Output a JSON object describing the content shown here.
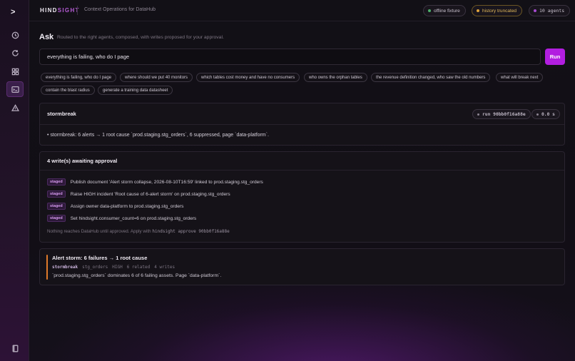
{
  "rail": {
    "logo": ">",
    "items": [
      {
        "name": "history-icon"
      },
      {
        "name": "refresh-icon"
      },
      {
        "name": "grid-icon"
      },
      {
        "name": "terminal-icon",
        "active": true
      },
      {
        "name": "alert-icon"
      }
    ],
    "bottom_icon": "book-icon"
  },
  "topbar": {
    "brand_main": "HIND",
    "brand_accent": "SIGHT",
    "subtitle": "Context Operations for DataHub",
    "pills": [
      {
        "label": "offline fixture",
        "dot_color": "#4caf6a"
      },
      {
        "label": "history truncated",
        "dot_color": "#e0a43a"
      },
      {
        "label": "10 agents",
        "dot_color": "#a64bd0"
      }
    ]
  },
  "ask": {
    "title": "Ask",
    "subtitle": "Routed to the right agents, composed, with writes proposed for your approval.",
    "query": "everything is failing, who do I page",
    "run_label": "Run"
  },
  "chips": [
    "everything is failing, who do I page",
    "where should we put 40 monitors",
    "which tables cost money and have no consumers",
    "who owns the orphan tables",
    "the revenue definition changed, who saw the old numbers",
    "what will break next",
    "contain the blast radius",
    "generate a training data datasheet"
  ],
  "result": {
    "agent": "stormbreak",
    "run_id": "run 90bb0f16a88e",
    "duration": "0.0 s",
    "summary": "• stormbreak: 6 alerts → 1 root cause `prod.staging.stg_orders`, 6 suppressed, page `data-platform`."
  },
  "approvals": {
    "title": "4 write(s) awaiting approval",
    "tag": "staged",
    "items": [
      "Publish document 'Alert storm collapse, 2026-08-10T16:59' linked to prod.staging.stg_orders",
      "Raise HIGH incident 'Root cause of 6-alert storm' on prod.staging.stg_orders",
      "Assign owner data-platform to prod.staging.stg_orders",
      "Set hindsight.consumer_count=6 on prod.staging.stg_orders"
    ],
    "note_prefix": "Nothing reaches DataHub until approved. Apply with",
    "note_cmd": "hindsight approve 90bb0f16a88e"
  },
  "storm": {
    "title": "Alert storm: 6 failures → 1 root cause",
    "owner": "stormbreak",
    "meta": [
      "stg_orders",
      "HIGH",
      "6 related",
      "4 writes"
    ],
    "text": "`prod.staging.stg_orders` dominates 6 of 6 failing assets. Page `data-platform`."
  },
  "colors": {
    "accent": "#b21ee0",
    "warning": "#e07a2a"
  }
}
